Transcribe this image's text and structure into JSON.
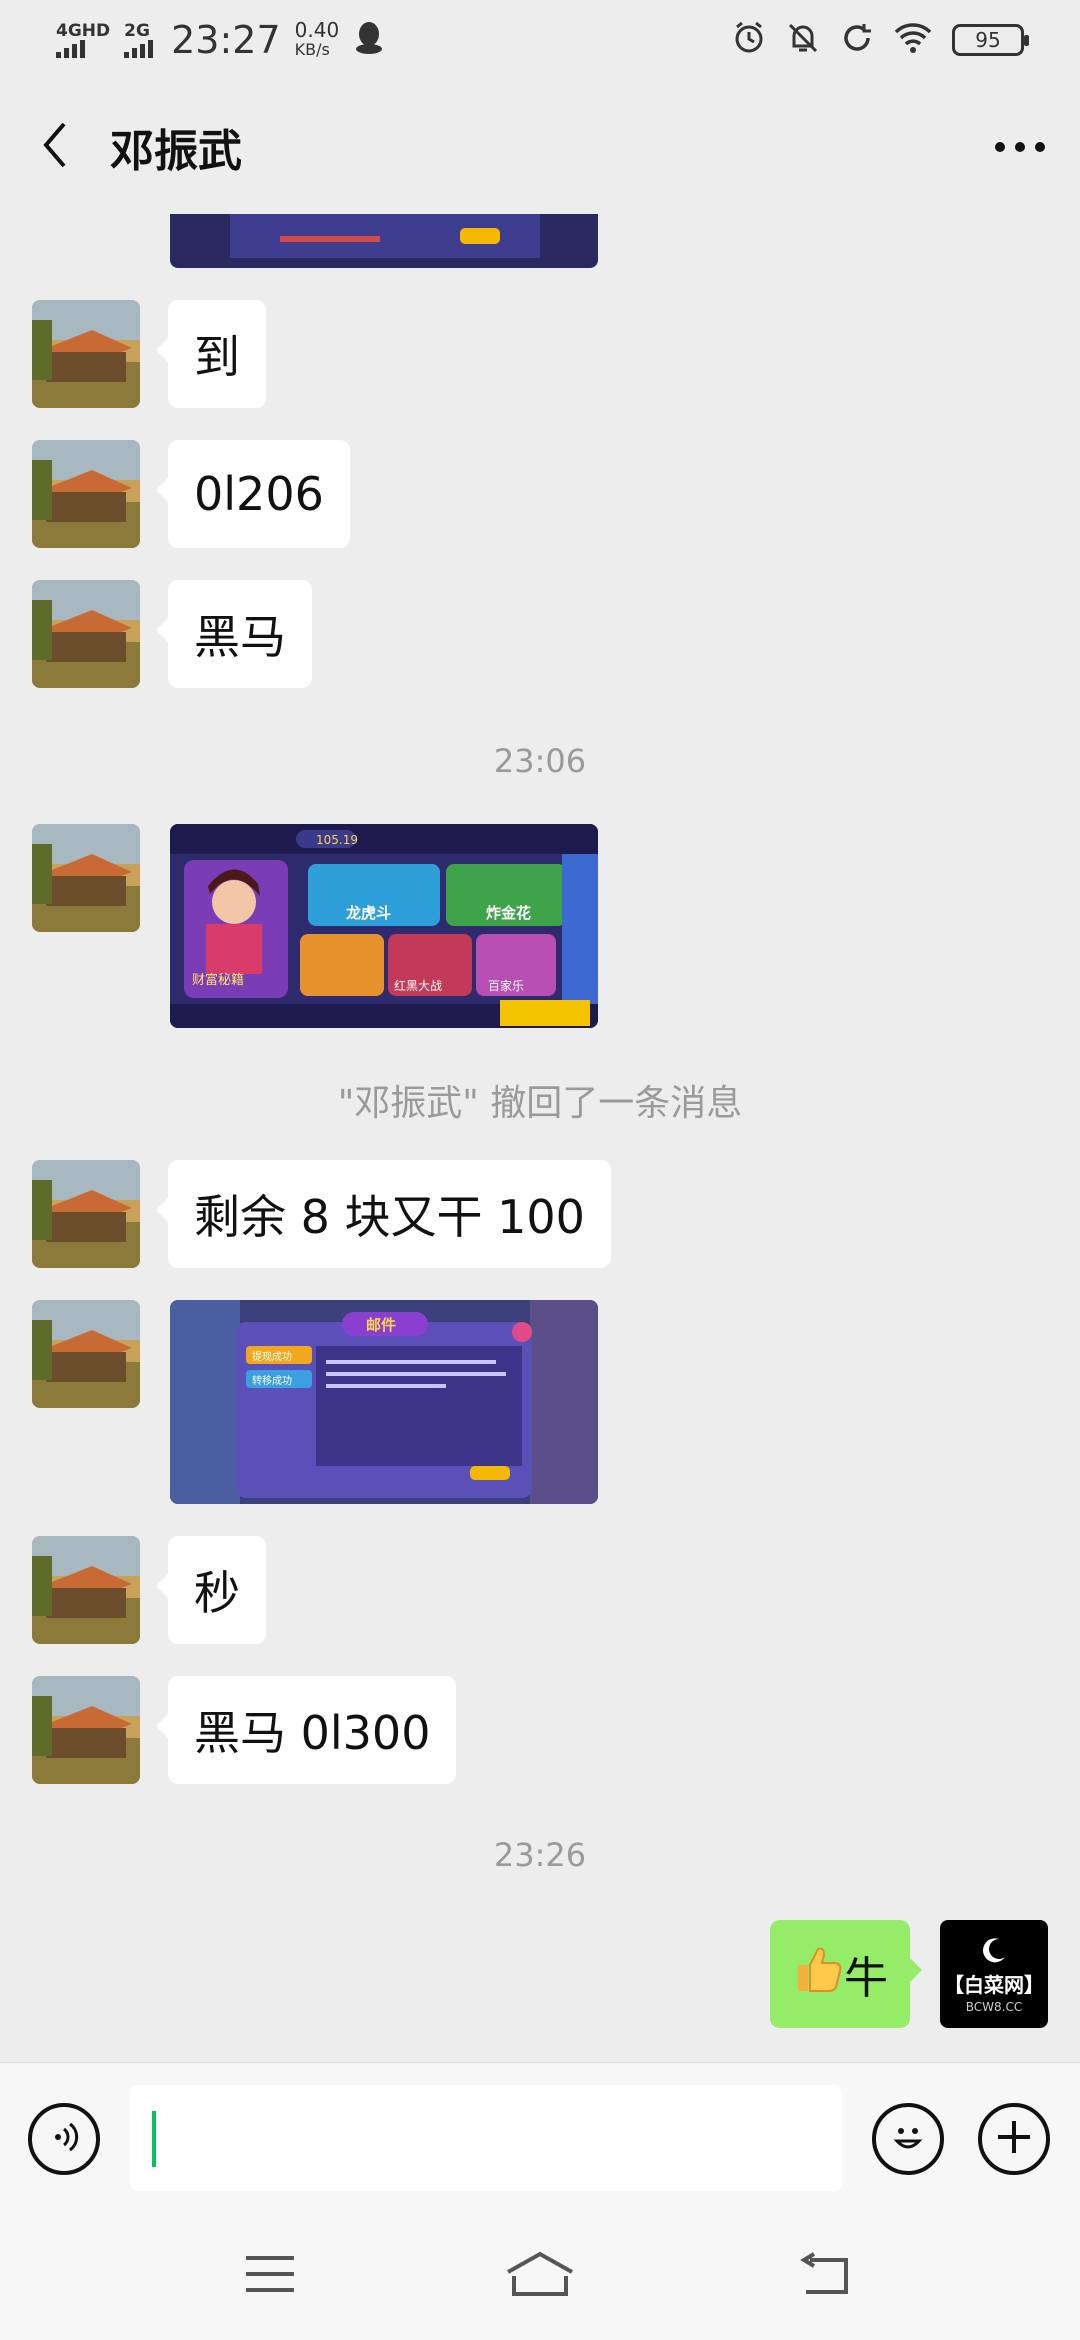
{
  "status_bar": {
    "net1": "4GHD",
    "net2": "2G",
    "time": "23:27",
    "speed_value": "0.40",
    "speed_unit": "KB/s",
    "battery": "95"
  },
  "header": {
    "title": "邓振武"
  },
  "messages": {
    "m1": "到",
    "m2": "0l206",
    "m3": "黑马",
    "m4": "剩余 8 块又干 100",
    "m5": "秒",
    "m6": "黑马 0l300",
    "outgoing": "牛"
  },
  "timestamps": {
    "t1": "23:06",
    "t2": "23:26"
  },
  "system_note": "\"邓振武\" 撤回了一条消息",
  "game_image": {
    "badge_tl": "105.19",
    "tile1": "龙虎斗",
    "tile2": "炸金花",
    "tile3": "红黑大战",
    "tile4": "百家乐",
    "promo": "财富秘籍"
  },
  "popup_image": {
    "title": "邮件",
    "btn1": "提现成功",
    "btn2": "转移成功"
  },
  "my_avatar": {
    "brand": "【白菜网】",
    "site": "BCW8.CC"
  },
  "colors": {
    "accent": "#07c160",
    "outgoing_bubble": "#95ec69",
    "background": "#ededed"
  },
  "icons": {
    "back": "chevron-left-icon",
    "more": "more-dots-icon",
    "voice": "voice-icon",
    "emoji": "emoji-icon",
    "plus": "plus-icon",
    "thumb": "thumbs-up-icon"
  }
}
